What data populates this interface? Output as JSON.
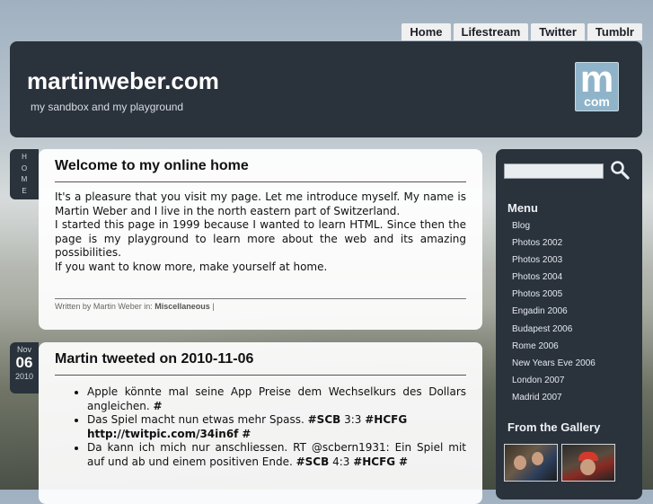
{
  "nav": [
    "Home",
    "Lifestream",
    "Twitter",
    "Tumblr"
  ],
  "header": {
    "title": "martinweber.com",
    "tagline": "my sandbox and my playground",
    "logo_top": "m",
    "logo_bottom": "com"
  },
  "home_tab": [
    "H",
    "O",
    "M",
    "E"
  ],
  "post1": {
    "title": "Welcome to my online home",
    "body": [
      "It's a pleasure that you visit my page. Let me introduce myself. My name is Martin Weber and I live in the north eastern part of Switzerland.",
      "I started this page in 1999 because I wanted to learn HTML. Since then the page is my playground to learn more about the web and its amazing possibilities.",
      "If you want to know more, make yourself at home."
    ],
    "footer_prefix": "Written by Martin Weber in: ",
    "footer_category": "Miscellaneous",
    "footer_suffix": " |"
  },
  "post2": {
    "date": {
      "month": "Nov",
      "day": "06",
      "year": "2010"
    },
    "title": "Martin tweeted on 2010-11-06",
    "tweets": [
      {
        "text": "Apple könnte mal seine App Preise dem Wechselkurs des Dollars angleichen. ",
        "bold": "#"
      },
      {
        "text": "Das Spiel macht nun etwas mehr Spass. ",
        "bold1": "#SCB",
        "mid": " 3:3 ",
        "bold2": "#HCFG",
        "bold3": "http://twitpic.com/34in6f",
        "bold4": "#"
      },
      {
        "text": "Da kann ich mich nur anschliessen. RT @scbern1931: Ein Spiel mit auf und ab und einem positiven Ende. ",
        "bold1": "#SCB",
        "mid": " 4:3 ",
        "bold2": "#HCFG",
        "bold3": "#"
      }
    ]
  },
  "sidebar": {
    "search_placeholder": "",
    "menu_title": "Menu",
    "menu": [
      "Blog",
      "Photos 2002",
      "Photos 2003",
      "Photos 2004",
      "Photos 2005",
      "Engadin 2006",
      "Budapest 2006",
      "Rome 2006",
      "New Years Eve 2006",
      "London 2007",
      "Madrid 2007"
    ],
    "gallery_title": "From the Gallery"
  }
}
